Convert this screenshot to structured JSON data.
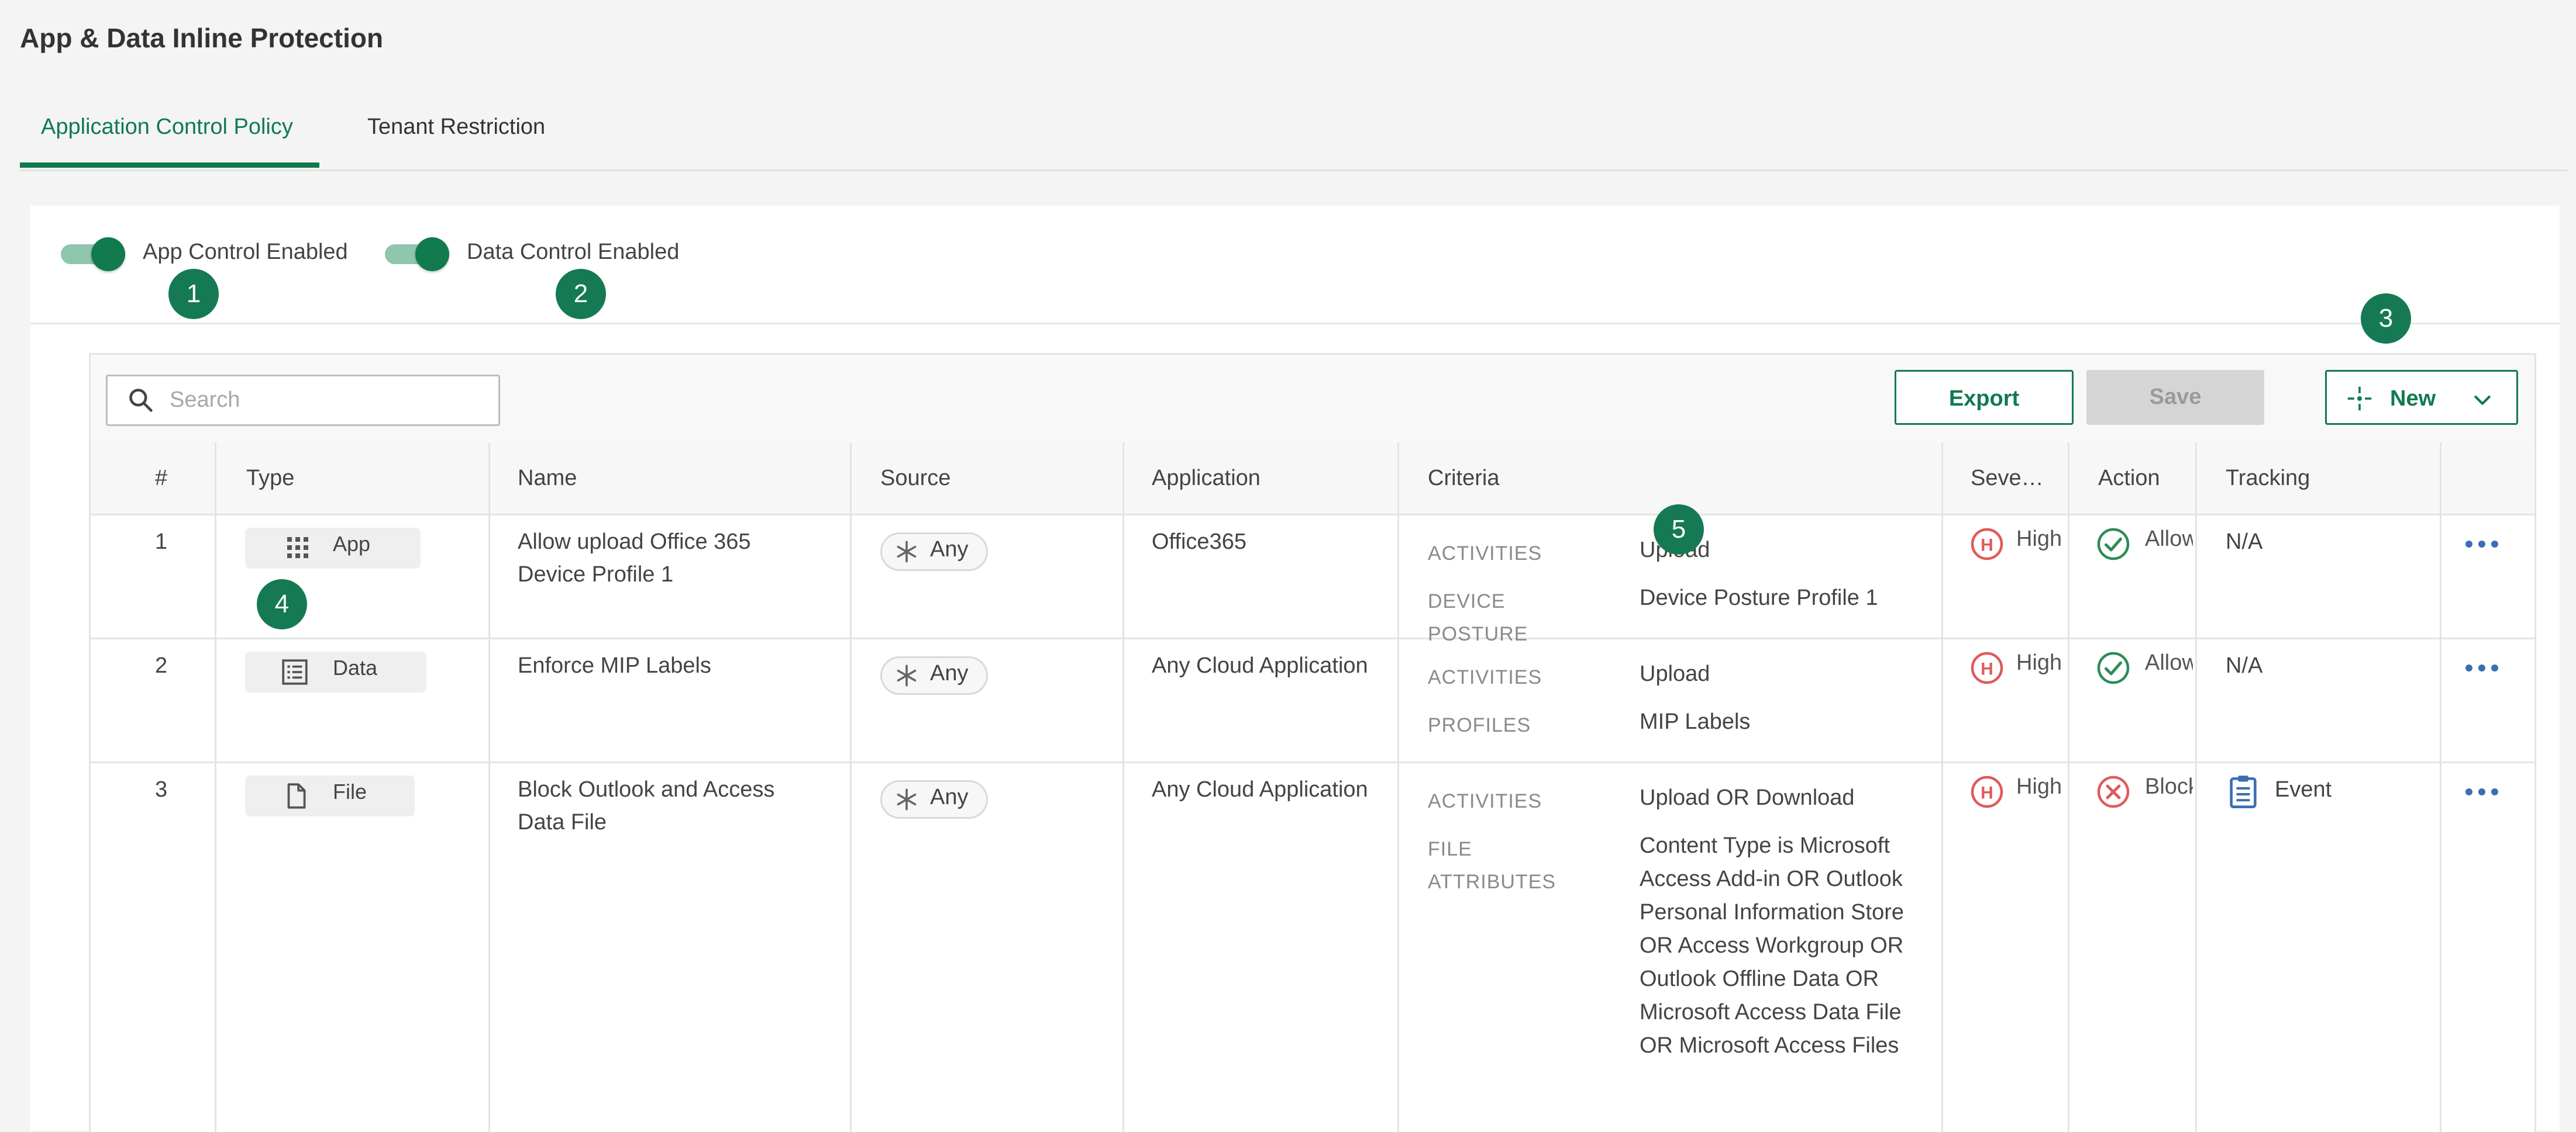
{
  "page_title": "App & Data Inline Protection",
  "tabs": [
    {
      "label": "Application Control Policy",
      "active": true
    },
    {
      "label": "Tenant Restriction",
      "active": false
    }
  ],
  "toggles": {
    "app_control": {
      "label": "App Control Enabled",
      "on": true
    },
    "data_control": {
      "label": "Data Control Enabled",
      "on": true
    }
  },
  "markers": [
    "1",
    "2",
    "3",
    "4",
    "5"
  ],
  "toolbar": {
    "search_placeholder": "Search",
    "export_label": "Export",
    "save_label": "Save",
    "new_label": "New"
  },
  "columns": [
    "#",
    "Type",
    "Name",
    "Source",
    "Application",
    "Criteria",
    "Seve…",
    "Action",
    "Tracking"
  ],
  "rows": [
    {
      "num": "1",
      "type": "App",
      "type_icon": "grid-icon",
      "name": "Allow upload Office 365 Device Profile 1",
      "source": "Any",
      "application": "Office365",
      "criteria": [
        {
          "key": "ACTIVITIES",
          "value": "Upload"
        },
        {
          "key": "DEVICE POSTURE",
          "value": "Device Posture Profile 1"
        }
      ],
      "severity": "High",
      "action": "Allow",
      "action_icon": "check-circle-icon",
      "tracking": "N/A"
    },
    {
      "num": "2",
      "type": "Data",
      "type_icon": "list-icon",
      "name": "Enforce MIP Labels",
      "source": "Any",
      "application": "Any Cloud Application",
      "criteria": [
        {
          "key": "ACTIVITIES",
          "value": "Upload"
        },
        {
          "key": "PROFILES",
          "value": "MIP Labels"
        }
      ],
      "severity": "High",
      "action": "Allow",
      "action_icon": "check-circle-icon",
      "tracking": "N/A"
    },
    {
      "num": "3",
      "type": "File",
      "type_icon": "file-icon",
      "name": "Block Outlook and Access Data File",
      "source": "Any",
      "application": "Any Cloud Application",
      "criteria": [
        {
          "key": "ACTIVITIES",
          "value": "Upload OR Download"
        },
        {
          "key": "FILE ATTRIBUTES",
          "value": "Content Type is Microsoft Access Add-in OR Outlook Personal Information Store OR Access Workgroup OR Outlook Offline Data OR Microsoft Access Data File OR Microsoft Access Files"
        }
      ],
      "severity": "High",
      "action": "Block",
      "action_icon": "x-circle-icon",
      "tracking": "Event",
      "tracking_icon": "clipboard-icon"
    }
  ],
  "colors": {
    "accent": "#117a4f",
    "severity_high": "#e05a5a",
    "allow": "#2e8b57",
    "block": "#e05a5a",
    "more": "#3a6fb0"
  }
}
